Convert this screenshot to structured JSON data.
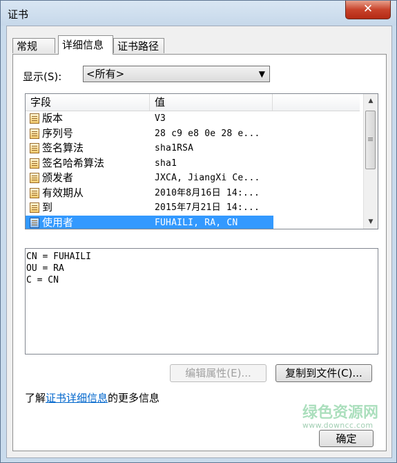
{
  "window": {
    "title": "证书",
    "close_glyph": "✕"
  },
  "tabs": [
    {
      "label": "常规"
    },
    {
      "label": "详细信息"
    },
    {
      "label": "证书路径"
    }
  ],
  "show": {
    "label": "显示(S):",
    "selected": "<所有>"
  },
  "list": {
    "columns": [
      "字段",
      "值"
    ],
    "rows": [
      {
        "field": "版本",
        "value": "V3"
      },
      {
        "field": "序列号",
        "value": "28 c9 e8 0e 28 e..."
      },
      {
        "field": "签名算法",
        "value": "sha1RSA"
      },
      {
        "field": "签名哈希算法",
        "value": "sha1"
      },
      {
        "field": "颁发者",
        "value": "JXCA, JiangXi Ce..."
      },
      {
        "field": "有效期从",
        "value": "2010年8月16日 14:..."
      },
      {
        "field": "到",
        "value": "2015年7月21日 14:..."
      },
      {
        "field": "使用者",
        "value": "FUHAILI, RA, CN"
      }
    ],
    "selected_index": 7
  },
  "detail_lines": [
    "CN = FUHAILI",
    "OU = RA",
    "C = CN"
  ],
  "buttons": {
    "edit_properties": "编辑属性(E)...",
    "copy_to_file": "复制到文件(C)...",
    "ok": "确定"
  },
  "learn_more": {
    "prefix": "了解",
    "link": "证书详细信息",
    "suffix": "的更多信息"
  },
  "watermark": {
    "text": "绿色资源网",
    "url": "www.downcc.com"
  }
}
